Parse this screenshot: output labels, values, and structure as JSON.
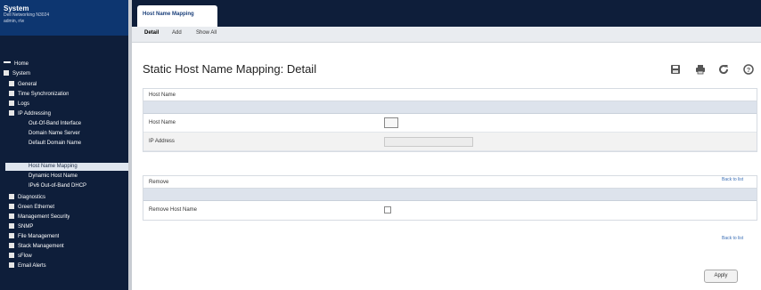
{
  "sidebar": {
    "title": "System",
    "subtitle_1": "Dell Networking N3024",
    "subtitle_2": "admin, r/w",
    "items": [
      {
        "label": "Home",
        "kind": "bar"
      },
      {
        "label": "System",
        "kind": "box"
      },
      {
        "label": "General",
        "kind": "box"
      },
      {
        "label": "Time Synchronization",
        "kind": "box"
      },
      {
        "label": "Logs",
        "kind": "box"
      },
      {
        "label": "IP Addressing",
        "kind": "box"
      },
      {
        "label": "Out-Of-Band Interface",
        "kind": "none"
      },
      {
        "label": "Domain Name Server",
        "kind": "none"
      },
      {
        "label": "Default Domain Name",
        "kind": "none"
      },
      {
        "label": "Host Name Mapping",
        "kind": "none"
      },
      {
        "label": "Dynamic Host Name",
        "kind": "none"
      },
      {
        "label": "IPv6 Out-of-Band DHCP",
        "kind": "none"
      },
      {
        "label": "Diagnostics",
        "kind": "box"
      },
      {
        "label": "Green Ethernet",
        "kind": "box"
      },
      {
        "label": "Management Security",
        "kind": "box"
      },
      {
        "label": "SNMP",
        "kind": "box"
      },
      {
        "label": "File Management",
        "kind": "box"
      },
      {
        "label": "Stack Management",
        "kind": "box"
      },
      {
        "label": "sFlow",
        "kind": "box"
      },
      {
        "label": "Email Alerts",
        "kind": "box"
      }
    ]
  },
  "topbar": {
    "active_tab": "Host Name Mapping"
  },
  "subtabs": [
    "Detail",
    "Add",
    "Show All"
  ],
  "page": {
    "title": "Static Host Name Mapping: Detail"
  },
  "toolbar_icons": [
    "save-icon",
    "print-icon",
    "refresh-icon",
    "help-icon"
  ],
  "host_panel": {
    "title": "Host Name",
    "rows": [
      {
        "label": "Host Name"
      },
      {
        "label": "IP Address"
      }
    ]
  },
  "remove_panel": {
    "title": "Remove",
    "rows": [
      {
        "label": "Remove Host Name"
      }
    ]
  },
  "back_to_list": "Back to list",
  "apply_label": "Apply"
}
